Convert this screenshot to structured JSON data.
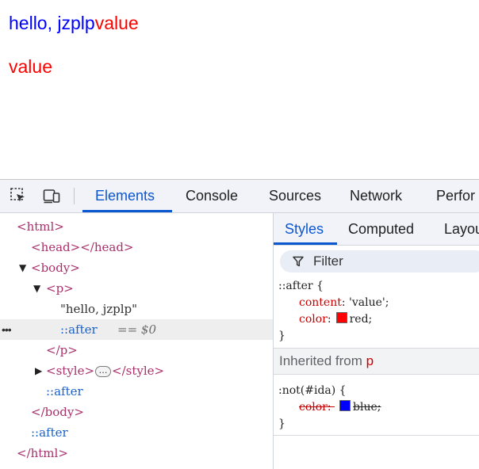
{
  "page": {
    "line1_text": "hello, jzplp",
    "line1_after": "value",
    "line2_after": "value",
    "text_color": "#0000ff",
    "after_color": "#ff0000"
  },
  "devtools": {
    "toolbar": {
      "inspect_icon": "inspect-element-icon",
      "device_icon": "device-toolbar-icon",
      "tabs": [
        "Elements",
        "Console",
        "Sources",
        "Network",
        "Perfor"
      ],
      "active_tab": "Elements"
    },
    "dom": {
      "html_open": "<html>",
      "head": "<head></head>",
      "body_open": "<body>",
      "p_open": "<p>",
      "text_node": "\"hello, jzplp\"",
      "p_after": "::after",
      "selected_suffix": "== $0",
      "p_close": "</p>",
      "style_open": "<style>",
      "style_dots": "…",
      "style_close": "</style>",
      "body_after": "::after",
      "body_close": "</body>",
      "html_after": "::after",
      "html_close": "</html>",
      "row_dots": "•••"
    },
    "side": {
      "tabs": [
        "Styles",
        "Computed",
        "Layou"
      ],
      "active_tab": "Styles",
      "filter_label": "Filter",
      "rule1": {
        "selector": "::after {",
        "p1_name": "content",
        "p1_value": "'value'",
        "p2_name": "color",
        "p2_value": "red",
        "p2_swatch": "#ff0000",
        "close": "}"
      },
      "inherited_label": "Inherited from",
      "inherited_tag": "p",
      "rule2": {
        "selector": ":not(#ida) {",
        "p1_name": "color",
        "p1_value": "blue",
        "p1_swatch": "#0000ff",
        "close": "}"
      }
    }
  }
}
